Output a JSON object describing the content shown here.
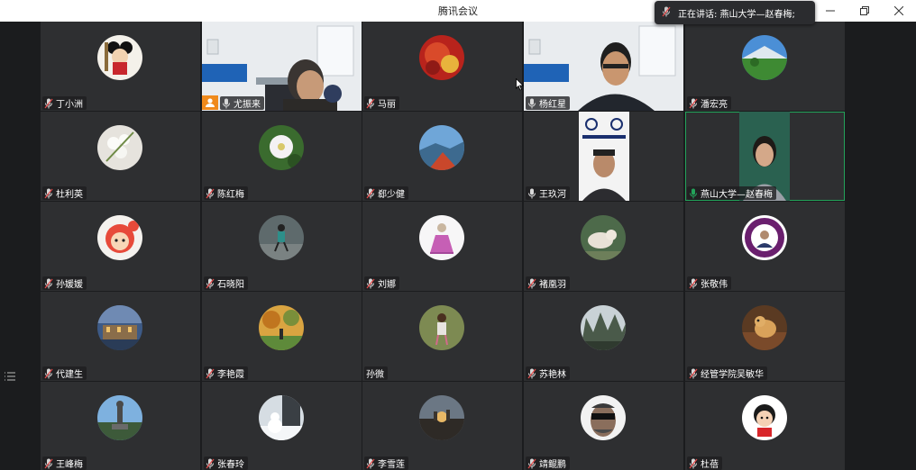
{
  "window": {
    "title": "腾讯会议",
    "minimize_icon": "minimize-icon",
    "restore_icon": "restore-icon",
    "close_icon": "close-icon"
  },
  "speaking_indicator": {
    "label": "正在讲话: 燕山大学—赵春梅;"
  },
  "colors": {
    "background": "#1b1c1e",
    "tile": "#2e2f31",
    "active_border": "#23a35a",
    "muted_mic": "#e04a4a",
    "host_badge": "#f08a1c"
  },
  "participants": [
    {
      "name": "丁小洲",
      "mic": "muted"
    },
    {
      "name": "尤振来",
      "mic": "on"
    },
    {
      "name": "马丽",
      "mic": "muted"
    },
    {
      "name": "杨红星",
      "mic": "on"
    },
    {
      "name": "潘宏亮",
      "mic": "muted"
    },
    {
      "name": "杜利英",
      "mic": "muted"
    },
    {
      "name": "陈红梅",
      "mic": "muted"
    },
    {
      "name": "郄少健",
      "mic": "muted"
    },
    {
      "name": "王玖河",
      "mic": "on"
    },
    {
      "name": "燕山大学—赵春梅",
      "mic": "speaking"
    },
    {
      "name": "孙媛媛",
      "mic": "muted"
    },
    {
      "name": "石晓阳",
      "mic": "muted"
    },
    {
      "name": "刘娜",
      "mic": "muted"
    },
    {
      "name": "褚凰羽",
      "mic": "muted"
    },
    {
      "name": "张敬伟",
      "mic": "muted"
    },
    {
      "name": "代建生",
      "mic": "muted"
    },
    {
      "name": "李艳霞",
      "mic": "muted"
    },
    {
      "name": "孙微",
      "mic": "none"
    },
    {
      "name": "苏艳林",
      "mic": "muted"
    },
    {
      "name": "经管学院吴敏华",
      "mic": "muted"
    },
    {
      "name": "王峰梅",
      "mic": "muted"
    },
    {
      "name": "张春玲",
      "mic": "muted"
    },
    {
      "name": "李雪莲",
      "mic": "muted"
    },
    {
      "name": "靖鲲鹏",
      "mic": "muted"
    },
    {
      "name": "杜蓓",
      "mic": "muted"
    }
  ]
}
